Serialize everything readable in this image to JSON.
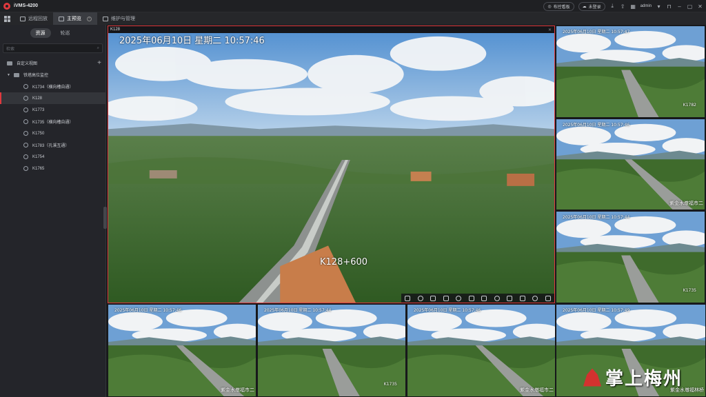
{
  "app": {
    "name": "iVMS-4200"
  },
  "tabs": [
    {
      "label": "远程回放"
    },
    {
      "label": "主预览"
    },
    {
      "label": "维护与管理"
    }
  ],
  "topbar": {
    "alarm_label": "布控看板",
    "login_label": "未登录",
    "user": "admin"
  },
  "sidebar": {
    "tab_resources": "资源",
    "tab_patrol": "轮巡",
    "search_placeholder": "检索",
    "custom_view": "自定义视图",
    "group": "铁塔高位监控",
    "cameras": [
      "K1734（横向槽自通）",
      "K128",
      "K1773",
      "K1735（横向槽自通）",
      "K1750",
      "K1783（孔溪互通）",
      "K1754",
      "K1765"
    ],
    "selected_index": 1
  },
  "main_view": {
    "window_title": "K128",
    "timestamp": "2025年06月10日  星期二  10:57:46",
    "location_label": "K128+600",
    "toolbar_icons": [
      "record-icon",
      "folder-icon",
      "home-icon",
      "fire-icon",
      "zoom-icon",
      "ptz-icon",
      "snapshot-icon",
      "record-circle-icon",
      "mic-icon",
      "digital-zoom-icon",
      "rotate-icon",
      "more-icon"
    ]
  },
  "tiles": [
    {
      "timestamp": "2025年06月10日  星期二  10:57:47",
      "name": "K1782",
      "loc": ""
    },
    {
      "timestamp": "2025年06月10日  星期二  10:57:46",
      "name": "",
      "loc": "紫金水墩福市二"
    },
    {
      "timestamp": "2025年06月10日  星期二  10:57:44",
      "name": "K1735",
      "loc": ""
    },
    {
      "timestamp": "2025年06月10日  星期二  10:57:46",
      "name": "",
      "loc": "紫金水墩福市二"
    },
    {
      "timestamp": "2025年06月10日  星期二  10:57:44",
      "name": "K1735",
      "loc": ""
    },
    {
      "timestamp": "2025年06月10日  星期二  10:57:46",
      "name": "",
      "loc": "紫金水墩福市二"
    },
    {
      "timestamp": "2025年06月10日  星期二  10:57:49",
      "name": "",
      "loc": "紫金水墩福林桥"
    }
  ],
  "watermark": {
    "text": "掌上梅州"
  },
  "colors": {
    "accent": "#e0393e",
    "panel": "#24252a",
    "sky": "#6fa4d8",
    "forest": "#3f6b2c"
  }
}
